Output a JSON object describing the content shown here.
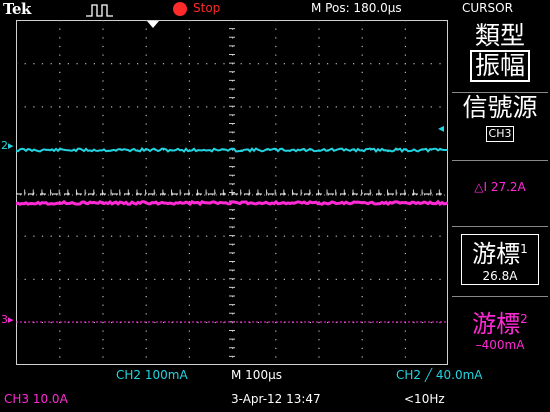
{
  "header": {
    "brand": "Tek",
    "trigger_icon": "acquisition-waveform-icon",
    "run_state": "Stop",
    "m_pos": "M Pos: 180.0µs",
    "menu_title": "CURSOR"
  },
  "channels": {
    "ch2_marker": "2",
    "ch3_marker": "3"
  },
  "menu": {
    "type_label": "類型",
    "amplitude_label": "振幅",
    "source_label": "信號源",
    "source_value": "CH3",
    "delta_label": "△I 27.2A",
    "cursor1_label": "游標",
    "cursor1_index": "1",
    "cursor1_value": "26.8A",
    "cursor2_label": "游標",
    "cursor2_index": "2",
    "cursor2_value": "–400mA"
  },
  "status": {
    "ch2_scale": "CH2   100mA",
    "timebase": "M 100µs",
    "trigger": "CH2 ╱ 40.0mA",
    "ch3_scale": "CH3   10.0A",
    "datetime": "3-Apr-12 13:47",
    "freq": "<10Hz"
  },
  "colors": {
    "ch2": "#22d3e0",
    "ch3": "#ff2ad6",
    "stop": "#ff2a2a",
    "grid": "#bbbbbb"
  }
}
